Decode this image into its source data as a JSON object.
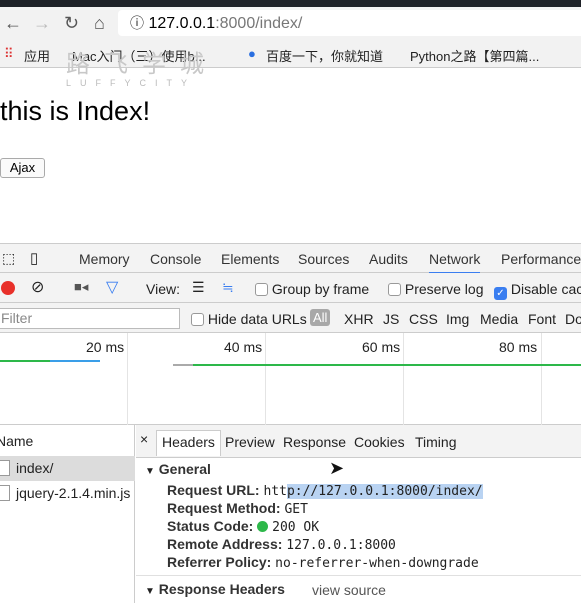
{
  "browser": {
    "url_host": "127.0.0.1",
    "url_rest": ":8000/index/",
    "bookmarks": [
      "应用",
      "Mac入门（三）使用b...",
      "百度一下，你就知道",
      "Python之路【第四篇..."
    ]
  },
  "page": {
    "watermark_cn": "路飞学城",
    "watermark_en": "LUFFYCITY",
    "heading": "this is Index!",
    "ajax_button": "Ajax"
  },
  "devtools": {
    "tabs": [
      "Memory",
      "Console",
      "Elements",
      "Sources",
      "Audits",
      "Network",
      "Performance"
    ],
    "active_tab": "Network",
    "toolbar": {
      "view_label": "View:",
      "group_by_frame": "Group by frame",
      "preserve_log": "Preserve log",
      "disable_cache": "Disable cac"
    },
    "filter": {
      "placeholder": "Filter",
      "hide_data_urls": "Hide data URLs",
      "types": [
        "All",
        "XHR",
        "JS",
        "CSS",
        "Img",
        "Media",
        "Font",
        "Do"
      ]
    },
    "timeline_ticks": [
      "20 ms",
      "40 ms",
      "60 ms",
      "80 ms"
    ],
    "name_header": "Name",
    "requests": [
      "index/",
      "jquery-2.1.4.min.js"
    ],
    "detail_tabs": [
      "Headers",
      "Preview",
      "Response",
      "Cookies",
      "Timing"
    ],
    "general_title": "General",
    "general": {
      "url_label": "Request URL:",
      "url_a": "htt",
      "url_b": "p://127.0.0.1:8000/index/",
      "method_label": "Request Method:",
      "method": "GET",
      "status_label": "Status Code:",
      "status": "200 OK",
      "remote_label": "Remote Address:",
      "remote": "127.0.0.1:8000",
      "referrer_label": "Referrer Policy:",
      "referrer": "no-referrer-when-downgrade"
    },
    "response_headers_title": "Response Headers",
    "view_source": "view source",
    "colors": {
      "record": "#e8302a",
      "accent": "#3a7ef0",
      "status_ok": "#2db84a",
      "selection": "#b9d3f2"
    }
  }
}
